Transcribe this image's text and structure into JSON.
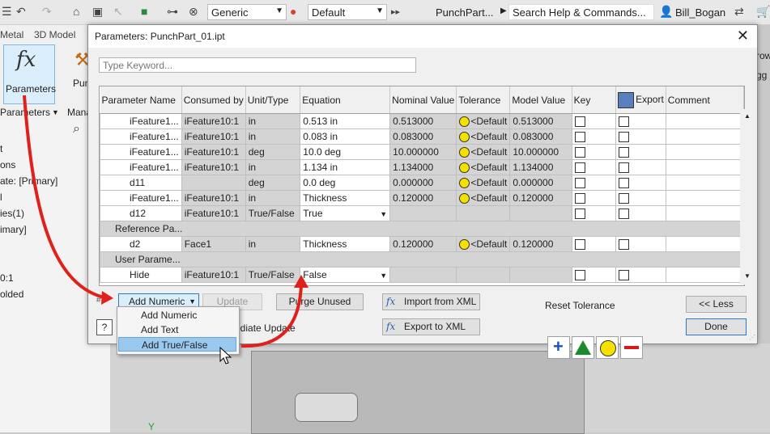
{
  "app": {
    "quick_access_combo": "Generic",
    "appearance_combo": "Default",
    "doc_title": "PunchPart...",
    "search_placeholder": "Search Help & Commands...",
    "user": "Bill_Bogan"
  },
  "ribbon": {
    "tab_sheet_metal": "Metal",
    "tab_3d_model": "3D Model",
    "parameters_button": "Parameters",
    "second_button": "Pun",
    "panel_label": "Parameters",
    "panel_label2": "Mana",
    "right_cut1": "row",
    "right_cut2": "gg"
  },
  "left_panel": {
    "items": [
      "t",
      "ons",
      "ate: [Primary]",
      "l",
      "ies(1)",
      "imary]",
      "0:1",
      "olded"
    ]
  },
  "viewport": {
    "axis_label": "Y"
  },
  "dialog": {
    "title": "Parameters: PunchPart_01.ipt",
    "keyword_placeholder": "Type Keyword...",
    "columns": [
      "Parameter Name",
      "Consumed by",
      "Unit/Type",
      "Equation",
      "Nominal Value",
      "Tolerance",
      "Model Value",
      "Key",
      "Export",
      "Comment"
    ],
    "rows": [
      {
        "name": "iFeature1...",
        "consumed": "iFeature10:1",
        "unit": "in",
        "equation": "0.513 in",
        "nominal": "0.513000",
        "tolerance": "<Default",
        "model": "0.513000"
      },
      {
        "name": "iFeature1...",
        "consumed": "iFeature10:1",
        "unit": "in",
        "equation": "0.083 in",
        "nominal": "0.083000",
        "tolerance": "<Default",
        "model": "0.083000"
      },
      {
        "name": "iFeature1...",
        "consumed": "iFeature10:1",
        "unit": "deg",
        "equation": "10.0 deg",
        "nominal": "10.000000",
        "tolerance": "<Default",
        "model": "10.000000"
      },
      {
        "name": "iFeature1...",
        "consumed": "iFeature10:1",
        "unit": "in",
        "equation": "1.134 in",
        "nominal": "1.134000",
        "tolerance": "<Default",
        "model": "1.134000"
      },
      {
        "name": "d11",
        "consumed": "",
        "unit": "deg",
        "equation": "0.0 deg",
        "nominal": "0.000000",
        "tolerance": "<Default",
        "model": "0.000000"
      },
      {
        "name": "iFeature1...",
        "consumed": "iFeature10:1",
        "unit": "in",
        "equation": "Thickness",
        "nominal": "0.120000",
        "tolerance": "<Default",
        "model": "0.120000"
      },
      {
        "name": "d12",
        "consumed": "iFeature10:1",
        "unit": "True/False",
        "equation": "True",
        "nominal": "",
        "tolerance": "",
        "model": ""
      }
    ],
    "group_reference": "Reference Pa...",
    "ref_row": {
      "name": "d2",
      "consumed": "Face1",
      "unit": "in",
      "equation": "Thickness",
      "nominal": "0.120000",
      "tolerance": "<Default",
      "model": "0.120000"
    },
    "group_user": "User Parame...",
    "user_row": {
      "name": "Hide",
      "consumed": "iFeature10:1",
      "unit": "True/False",
      "equation": "False"
    },
    "add_numeric": "Add Numeric",
    "update": "Update",
    "purge_unused": "Purge Unused",
    "import_xml": "Import from XML",
    "export_xml": "Export to XML",
    "immediate_update": "ediate Update",
    "reset_tolerance": "Reset Tolerance",
    "less": "<< Less",
    "done": "Done",
    "menu_items": [
      "Add Numeric",
      "Add Text",
      "Add True/False"
    ]
  },
  "colors": {
    "highlight": "#99c9ef",
    "annotation_arrow": "#e0201a",
    "tolerance_yellow": "#f5e100"
  }
}
